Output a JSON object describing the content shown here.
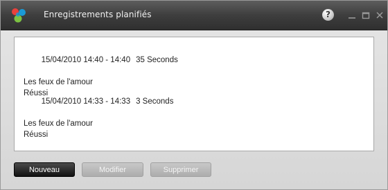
{
  "window": {
    "title": "Enregistrements planifiés",
    "help_label": "?"
  },
  "icons": {
    "app": "app-logo-icon",
    "help": "help-icon",
    "minimize": "minimize-icon",
    "maximize": "maximize-icon",
    "close": "close-icon"
  },
  "recordings": [
    {
      "datetime": "15/04/2010 14:40 - 14:40",
      "duration": "35 Seconds",
      "program": "Les feux de l'amour",
      "status": "Réussi"
    },
    {
      "datetime": "15/04/2010 14:33 - 14:33",
      "duration": "3 Seconds",
      "program": "Les feux de l'amour",
      "status": "Réussi"
    }
  ],
  "buttons": {
    "new_label": "Nouveau",
    "edit_label": "Modifier",
    "delete_label": "Supprimer"
  },
  "colors": {
    "titlebar": "#3e3e3e",
    "primary_button": "#111111",
    "disabled_button": "#adadad",
    "logo_blue": "#1a9ad6",
    "logo_green": "#7cc242",
    "logo_red": "#e8413c"
  }
}
